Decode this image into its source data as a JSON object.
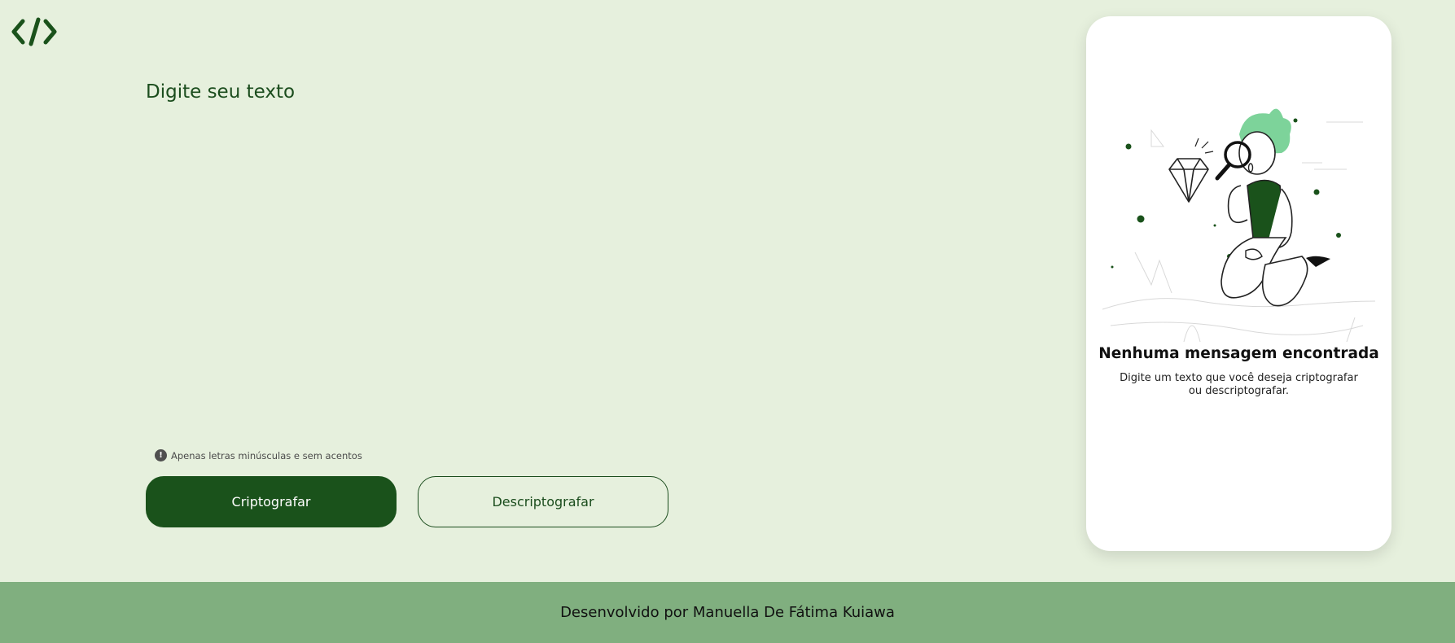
{
  "header": {
    "logo_icon": "code-brackets-icon"
  },
  "input": {
    "placeholder": "Digite seu texto",
    "value": ""
  },
  "hint": {
    "icon": "exclamation-circle-icon",
    "text": "Apenas letras minúsculas e sem acentos"
  },
  "actions": {
    "encrypt_label": "Criptografar",
    "decrypt_label": "Descriptografar"
  },
  "output": {
    "illustration": "person-with-magnifying-glass-diamond",
    "title": "Nenhuma mensagem encontrada",
    "description": "Digite um texto que você deseja criptografar ou descriptografar."
  },
  "footer": {
    "text": "Desenvolvido por Manuella De Fátima Kuiawa"
  },
  "colors": {
    "background": "#e6f0dd",
    "primary": "#1a521b",
    "footer": "#80af7f",
    "card": "#ffffff",
    "accent": "#7dd39a"
  }
}
